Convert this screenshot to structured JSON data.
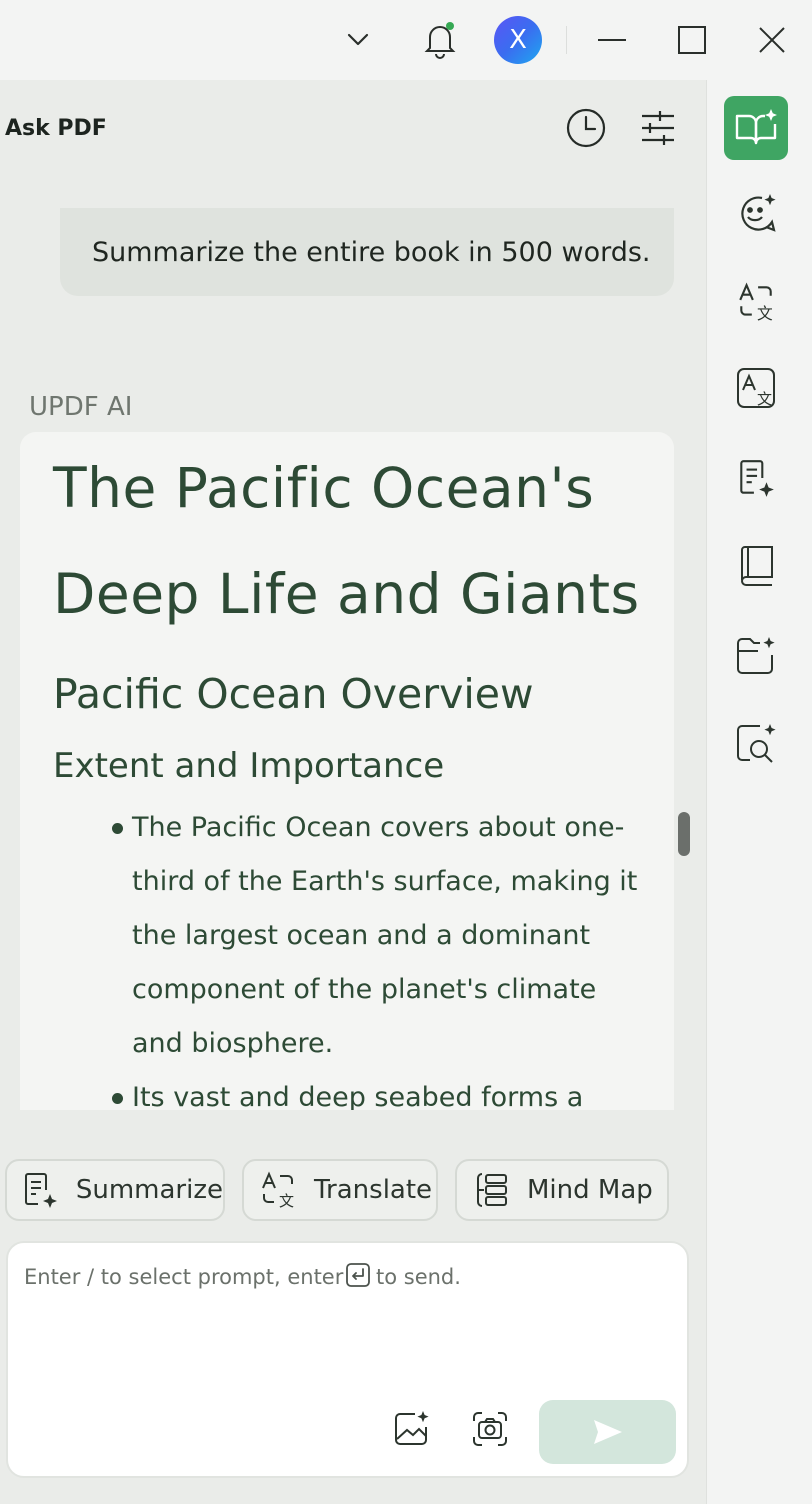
{
  "titlebar": {
    "dropdown_icon": "chevron-down-icon",
    "notification_icon": "bell-icon",
    "notification_dot_color": "#35a853",
    "avatar_letter": "X",
    "minimize_icon": "minimize-icon",
    "maximize_icon": "maximize-icon",
    "close_icon": "close-icon"
  },
  "panel": {
    "title": "Ask PDF",
    "history_icon": "clock-icon",
    "settings_icon": "sliders-icon"
  },
  "chat": {
    "user_message": "Summarize the entire book in 500 words.",
    "ai_label": "UPDF AI",
    "answer": {
      "title_line1": "The Pacific Ocean's",
      "title_line2": "Deep Life and Giants",
      "section_heading": "Pacific Ocean Overview",
      "subsection_heading": "Extent and Importance",
      "bullets": [
        {
          "lines": [
            "The Pacific Ocean covers about one-",
            "third of the Earth's surface, making it",
            "the largest ocean and a dominant",
            "component of the planet's climate",
            "and biosphere."
          ]
        },
        {
          "lines": [
            "Its vast and deep seabed forms a"
          ]
        }
      ]
    }
  },
  "quick_actions": [
    {
      "label": "Summarize",
      "icon": "summarize-icon"
    },
    {
      "label": "Translate",
      "icon": "translate-icon"
    },
    {
      "label": "Mind Map",
      "icon": "mind-map-icon"
    }
  ],
  "input": {
    "placeholder_part1": "Enter / to select prompt, enter",
    "enter_key_icon": "enter-key-icon",
    "placeholder_part2": "to send.",
    "image_ai_icon": "image-ai-icon",
    "screenshot_icon": "camera-icon",
    "send_icon": "send-icon"
  },
  "rail": {
    "items": [
      {
        "icon": "ask-pdf-book-icon",
        "active": true
      },
      {
        "icon": "chat-ai-icon",
        "active": false
      },
      {
        "icon": "translate-icon",
        "active": false
      },
      {
        "icon": "translate-doc-icon",
        "active": false
      },
      {
        "icon": "summarize-doc-icon",
        "active": false
      },
      {
        "icon": "book-icon",
        "active": false
      },
      {
        "icon": "folder-ai-icon",
        "active": false
      },
      {
        "icon": "search-ai-icon",
        "active": false
      }
    ],
    "accent_color": "#3fa563"
  }
}
